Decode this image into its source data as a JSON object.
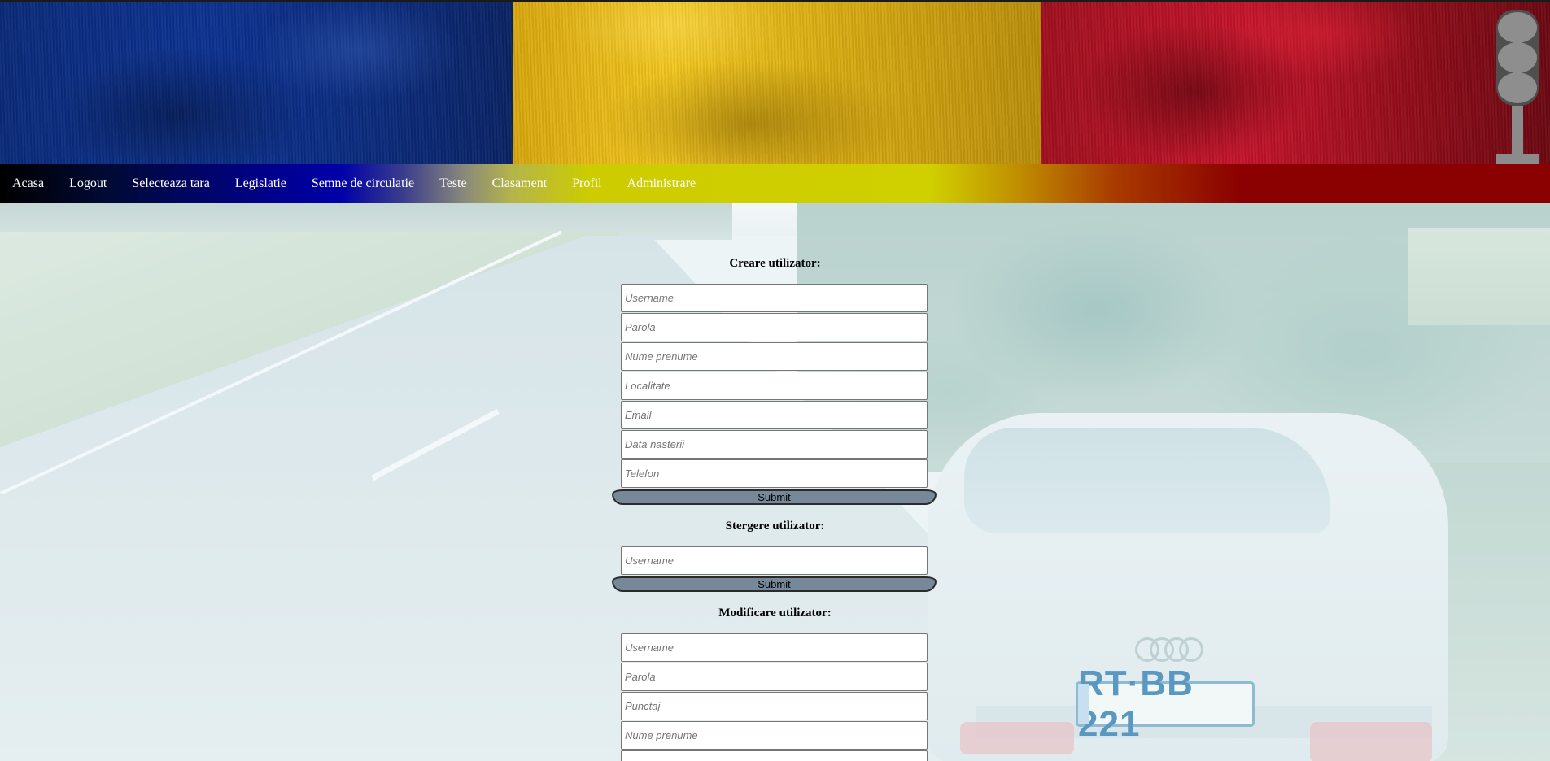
{
  "header": {
    "flag_colors": [
      "#0c3190",
      "#f2c61d",
      "#c4142a"
    ],
    "logo_icon": "traffic-light-icon"
  },
  "nav": {
    "items": [
      {
        "label": "Acasa"
      },
      {
        "label": "Logout"
      },
      {
        "label": "Selecteaza tara"
      },
      {
        "label": "Legislatie"
      },
      {
        "label": "Semne de circulatie"
      },
      {
        "label": "Teste"
      },
      {
        "label": "Clasament"
      },
      {
        "label": "Profil"
      },
      {
        "label": "Administrare"
      }
    ]
  },
  "background": {
    "plate_text": "RT·BB 221"
  },
  "create_user": {
    "title": "Creare utilizator:",
    "fields": [
      {
        "placeholder": "Username",
        "value": ""
      },
      {
        "placeholder": "Parola",
        "value": ""
      },
      {
        "placeholder": "Nume prenume",
        "value": ""
      },
      {
        "placeholder": "Localitate",
        "value": ""
      },
      {
        "placeholder": "Email",
        "value": ""
      },
      {
        "placeholder": "Data nasterii",
        "value": ""
      },
      {
        "placeholder": "Telefon",
        "value": ""
      }
    ],
    "submit_label": "Submit"
  },
  "delete_user": {
    "title": "Stergere utilizator:",
    "fields": [
      {
        "placeholder": "Username",
        "value": ""
      }
    ],
    "submit_label": "Submit"
  },
  "modify_user": {
    "title": "Modificare utilizator:",
    "fields": [
      {
        "placeholder": "Username",
        "value": ""
      },
      {
        "placeholder": "Parola",
        "value": ""
      },
      {
        "placeholder": "Punctaj",
        "value": ""
      },
      {
        "placeholder": "Nume prenume",
        "value": ""
      },
      {
        "placeholder": "",
        "value": ""
      }
    ]
  }
}
